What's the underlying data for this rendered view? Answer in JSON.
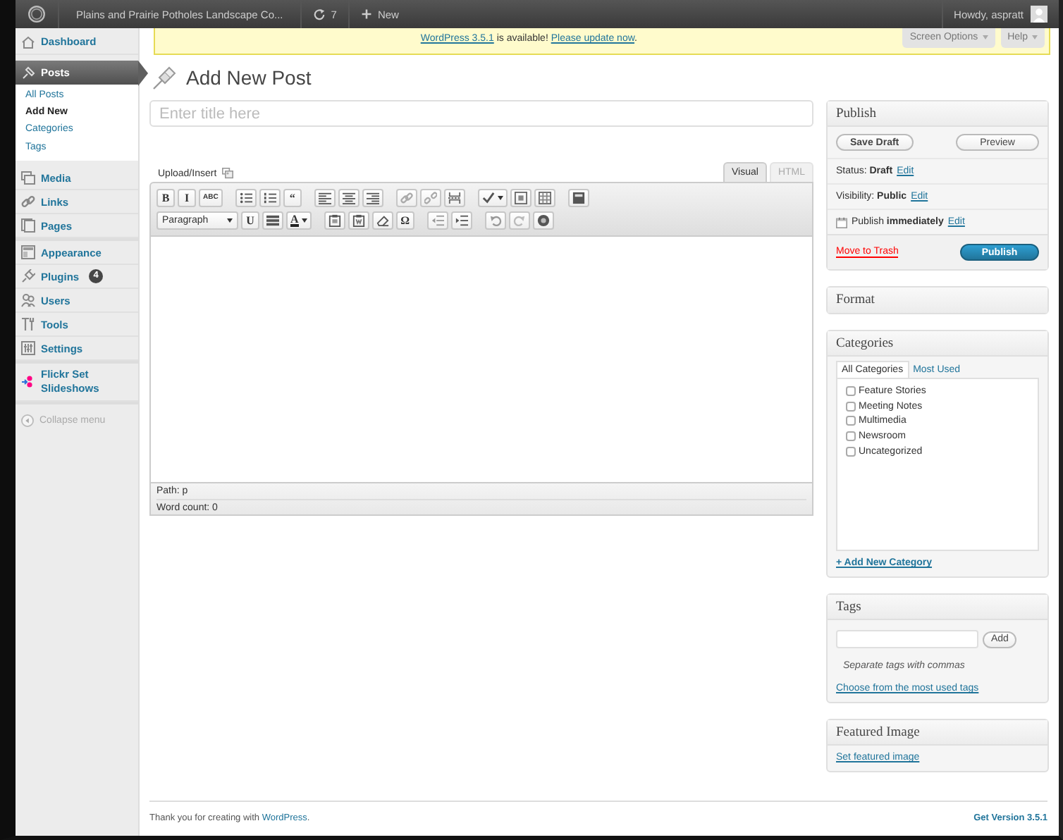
{
  "admin_bar": {
    "site_title": "Plains and Prairie Potholes Landscape Co...",
    "updates": "7",
    "new_label": "New",
    "greeting": "Howdy, aspratt"
  },
  "sidebar": {
    "groups": [
      [
        {
          "label": "Dashboard",
          "selected": false
        },
        {
          "label": "Posts",
          "selected": true,
          "children": [
            {
              "label": "All Posts",
              "selected": false
            },
            {
              "label": "Add New",
              "selected": true
            },
            {
              "label": "Categories",
              "selected": false
            },
            {
              "label": "Tags",
              "selected": false
            }
          ]
        },
        {
          "label": "Media",
          "selected": false
        },
        {
          "label": "Links",
          "selected": false
        },
        {
          "label": "Pages",
          "selected": false
        }
      ],
      [
        {
          "label": "Appearance",
          "selected": false
        },
        {
          "label": "Plugins",
          "selected": false,
          "badge": "4"
        },
        {
          "label": "Users",
          "selected": false
        },
        {
          "label": "Tools",
          "selected": false
        },
        {
          "label": "Settings",
          "selected": false
        }
      ],
      [
        {
          "label": "Flickr Set Slideshows",
          "selected": false
        }
      ]
    ],
    "collapse": "Collapse menu"
  },
  "notice": {
    "version_link": "WordPress 3.5.1",
    "message": "is available!",
    "update_link": "Please update now",
    "punctuation": "."
  },
  "screen_tabs": [
    "Screen Options",
    "Help"
  ],
  "page_title": "Add New Post",
  "title_field": {
    "placeholder": "Enter title here"
  },
  "editor": {
    "upload_label": "Upload/Insert",
    "tabs": [
      {
        "label": "Visual",
        "selected": true
      },
      {
        "label": "HTML",
        "selected": false
      }
    ],
    "toolbar_rows": [
      [
        {
          "kind": "text",
          "label": "B"
        },
        {
          "kind": "text",
          "label": "I"
        },
        {
          "kind": "text",
          "label": "ABC"
        },
        {
          "kind": "gap"
        },
        {
          "kind": "icon"
        },
        {
          "kind": "icon"
        },
        {
          "kind": "text",
          "label": "“"
        },
        {
          "kind": "gap"
        },
        {
          "kind": "icon"
        },
        {
          "kind": "icon"
        },
        {
          "kind": "icon"
        },
        {
          "kind": "gap"
        },
        {
          "kind": "icon"
        },
        {
          "kind": "icon"
        },
        {
          "kind": "icon"
        },
        {
          "kind": "gap"
        },
        {
          "kind": "icon_menu"
        },
        {
          "kind": "icon"
        },
        {
          "kind": "icon"
        },
        {
          "kind": "gap"
        },
        {
          "kind": "icon"
        }
      ],
      [
        {
          "kind": "select",
          "label": "Paragraph"
        },
        {
          "kind": "text",
          "label": "U"
        },
        {
          "kind": "icon"
        },
        {
          "kind": "text_menu",
          "label": "A"
        },
        {
          "kind": "gap"
        },
        {
          "kind": "icon"
        },
        {
          "kind": "icon"
        },
        {
          "kind": "icon"
        },
        {
          "kind": "text",
          "label": "Ω"
        },
        {
          "kind": "gap"
        },
        {
          "kind": "icon"
        },
        {
          "kind": "icon"
        },
        {
          "kind": "gap"
        },
        {
          "kind": "icon"
        },
        {
          "kind": "icon"
        },
        {
          "kind": "icon"
        }
      ]
    ],
    "path": "Path: p",
    "word_count": "Word count: 0"
  },
  "publish": {
    "title": "Publish",
    "save_draft": "Save Draft",
    "preview": "Preview",
    "rows": [
      {
        "kind": "plain",
        "text": "Status: **Draft**",
        "link": "Edit"
      },
      {
        "kind": "plain",
        "text": "Visibility: **Public**",
        "link": "Edit"
      },
      {
        "kind": "calendar",
        "text": "Publish **immediately**",
        "link": "Edit"
      }
    ],
    "trash": "Move to Trash",
    "publish_button": "Publish"
  },
  "format": {
    "title": "Format"
  },
  "categories": {
    "title": "Categories",
    "tabs": [
      {
        "label": "All Categories",
        "selected": true
      },
      {
        "label": "Most Used",
        "selected": false
      }
    ],
    "items": [
      {
        "label": "Feature Stories",
        "checked": false
      },
      {
        "label": "Meeting Notes",
        "checked": false
      },
      {
        "label": "Multimedia",
        "checked": false
      },
      {
        "label": "Newsroom",
        "checked": false
      },
      {
        "label": "Uncategorized",
        "checked": false
      }
    ],
    "add_link": "+ Add New Category"
  },
  "tags": {
    "title": "Tags",
    "add_button": "Add",
    "hint": "Separate tags with commas",
    "choose_link": "Choose from the most used tags"
  },
  "featured_image": {
    "title": "Featured Image",
    "link": "Set featured image"
  },
  "footer": {
    "thanks": "Thank you for creating with",
    "thanks_link": "WordPress",
    "punctuation": ".",
    "version": "Get Version 3.5.1"
  }
}
